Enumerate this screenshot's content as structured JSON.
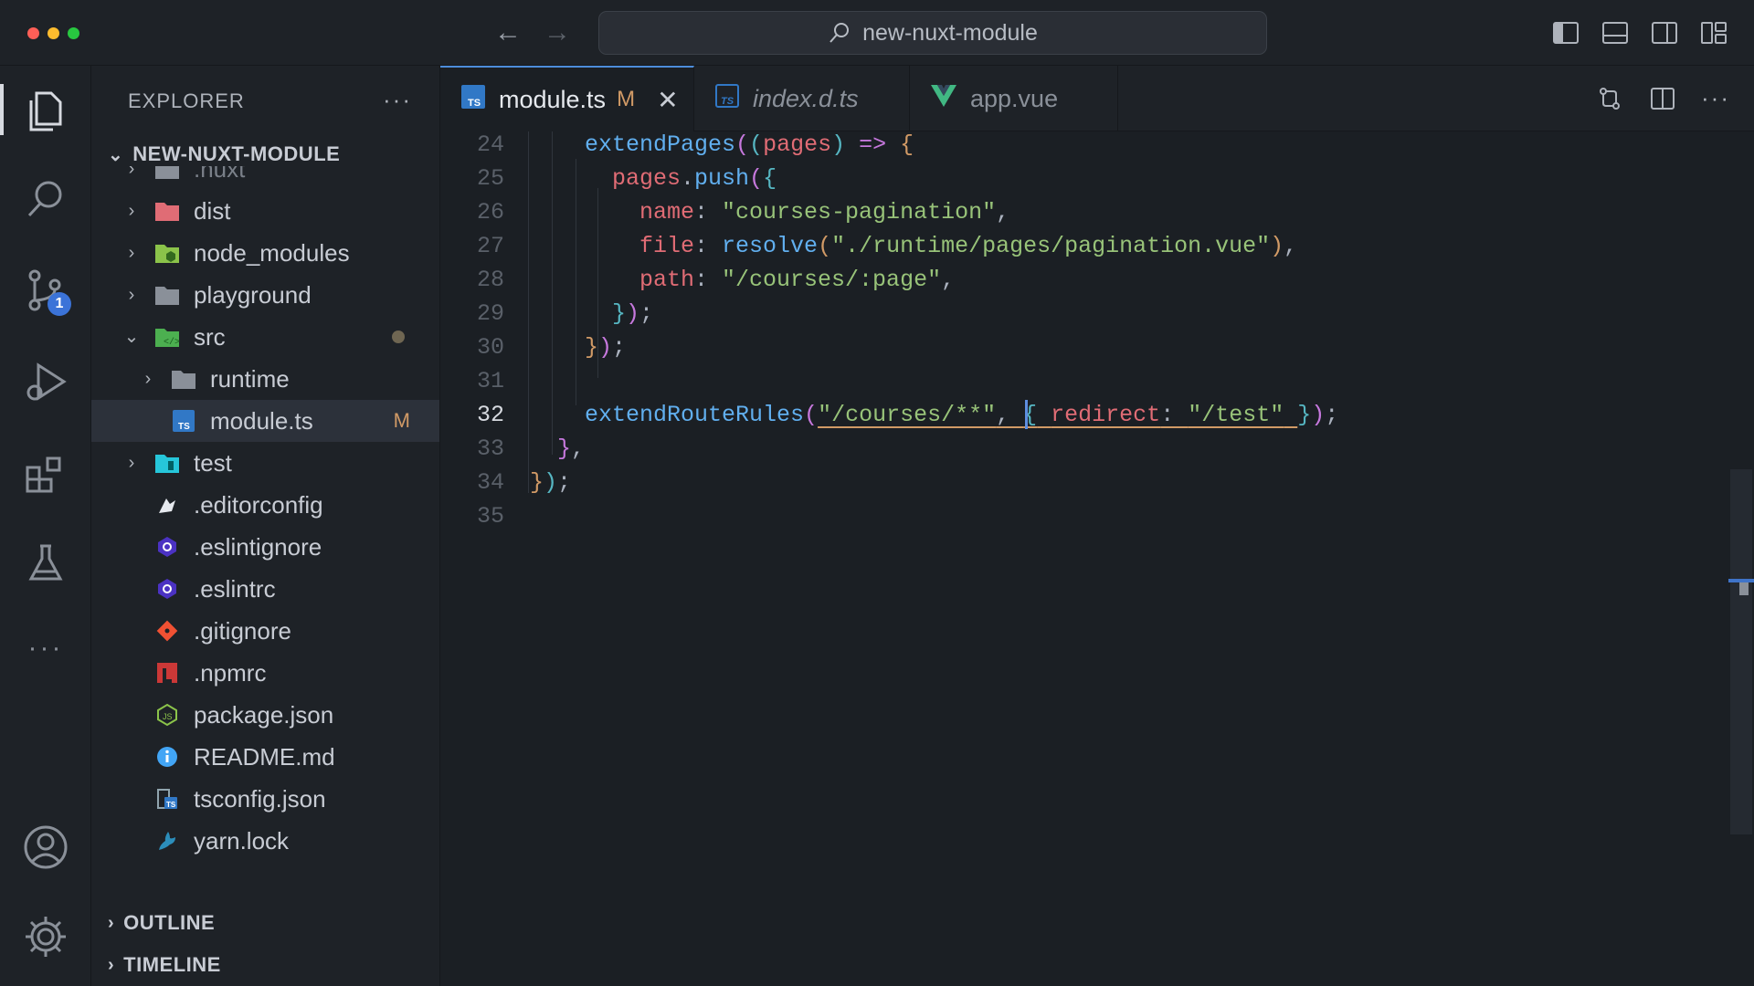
{
  "window": {
    "search_label": "new-nuxt-module"
  },
  "activity": {
    "badge": "1"
  },
  "sidebar": {
    "header": "EXPLORER",
    "root": "NEW-NUXT-MODULE",
    "items": [
      {
        "name": ".nuxt",
        "type": "folder",
        "chev": "right",
        "depth": 0,
        "icon": "folder-gray-icon"
      },
      {
        "name": "dist",
        "type": "folder",
        "chev": "right",
        "depth": 0,
        "icon": "folder-red-icon"
      },
      {
        "name": "node_modules",
        "type": "folder",
        "chev": "right",
        "depth": 0,
        "icon": "folder-node-icon"
      },
      {
        "name": "playground",
        "type": "folder",
        "chev": "right",
        "depth": 0,
        "icon": "folder-gray-icon"
      },
      {
        "name": "src",
        "type": "folder",
        "chev": "down",
        "depth": 0,
        "icon": "folder-src-icon"
      },
      {
        "name": "runtime",
        "type": "folder",
        "chev": "right",
        "depth": 1,
        "icon": "folder-gray-icon"
      },
      {
        "name": "module.ts",
        "type": "file",
        "depth": 1,
        "icon": "typescript-icon",
        "status": "M"
      },
      {
        "name": "test",
        "type": "folder",
        "chev": "right",
        "depth": 0,
        "icon": "folder-test-icon"
      },
      {
        "name": ".editorconfig",
        "type": "file",
        "depth": 0,
        "icon": "editorconfig-icon"
      },
      {
        "name": ".eslintignore",
        "type": "file",
        "depth": 0,
        "icon": "eslint-icon"
      },
      {
        "name": ".eslintrc",
        "type": "file",
        "depth": 0,
        "icon": "eslint-icon"
      },
      {
        "name": ".gitignore",
        "type": "file",
        "depth": 0,
        "icon": "git-icon"
      },
      {
        "name": ".npmrc",
        "type": "file",
        "depth": 0,
        "icon": "npm-icon"
      },
      {
        "name": "package.json",
        "type": "file",
        "depth": 0,
        "icon": "nodejs-icon"
      },
      {
        "name": "README.md",
        "type": "file",
        "depth": 0,
        "icon": "info-icon"
      },
      {
        "name": "tsconfig.json",
        "type": "file",
        "depth": 0,
        "icon": "tsconfig-icon"
      },
      {
        "name": "yarn.lock",
        "type": "file",
        "depth": 0,
        "icon": "yarn-icon"
      }
    ],
    "outline": "OUTLINE",
    "timeline": "TIMELINE"
  },
  "tabs": [
    {
      "label": "module.ts",
      "modified": "M",
      "active": true,
      "icon": "typescript-icon"
    },
    {
      "label": "index.d.ts",
      "active": false,
      "icon": "typescript-icon"
    },
    {
      "label": "app.vue",
      "active": false,
      "icon": "vue-icon"
    }
  ],
  "editor": {
    "current_line": "32",
    "lines": [
      {
        "n": "24",
        "code": "extendPages((pages) => {"
      },
      {
        "n": "25",
        "code": "pages.push({"
      },
      {
        "n": "26",
        "code": "name: \"courses-pagination\","
      },
      {
        "n": "27",
        "code": "file: resolve(\"./runtime/pages/pagination.vue\"),"
      },
      {
        "n": "28",
        "code": "path: \"/courses/:page\","
      },
      {
        "n": "29",
        "code": "});"
      },
      {
        "n": "30",
        "code": "});"
      },
      {
        "n": "31",
        "code": ""
      },
      {
        "n": "32",
        "code": "extendRouteRules(\"/courses/**\", { redirect: \"/test\" });"
      },
      {
        "n": "33",
        "code": "},"
      },
      {
        "n": "34",
        "code": "});"
      },
      {
        "n": "35",
        "code": ""
      }
    ]
  },
  "colors": {
    "accent": "#4d8ddb",
    "modified": "#d19a66",
    "background": "#1b1f24"
  }
}
